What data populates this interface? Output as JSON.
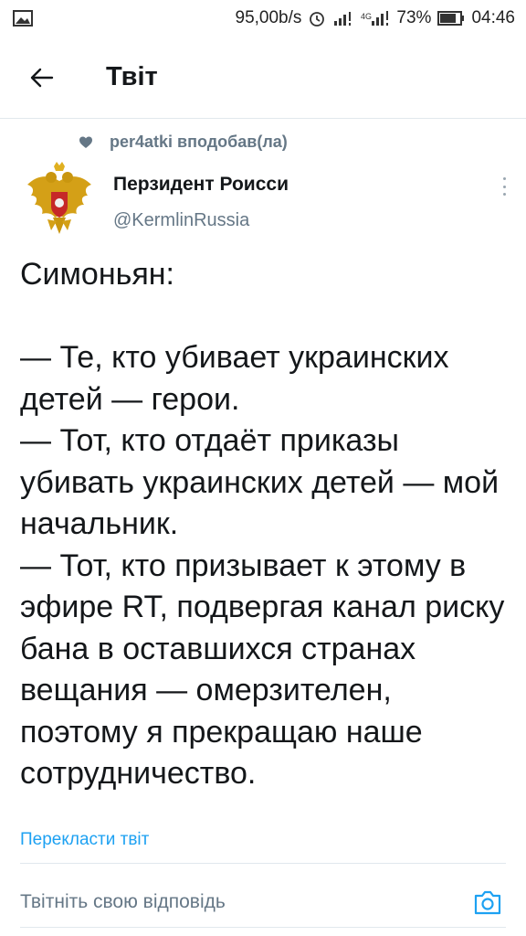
{
  "status_bar": {
    "speed": "95,00b/s",
    "network": "4G",
    "battery": "73%",
    "time": "04:46",
    "icons": [
      "image-icon",
      "alarm-icon",
      "signal-icon",
      "signal-4g-icon",
      "battery-icon"
    ]
  },
  "header": {
    "title": "Твіт",
    "back_icon": "arrow-left-icon"
  },
  "social_context": {
    "text": "per4atki вподобав(ла)",
    "icon": "heart-icon"
  },
  "tweet": {
    "author_name": "Перзидент Роисси",
    "author_handle": "@KermlinRussia",
    "avatar": "coat-of-arms-avatar",
    "text": "Симоньян:\n\n— Те, кто убивает украинских детей — герои.\n— Тот, кто отдаёт приказы убивать украинских детей — мой начальник.\n— Тот, кто призывает к этому в эфире RT, подвергая канал риску бана в оставшихся странах вещания — омерзителен, поэтому я прекращаю наше сотрудничество.",
    "translate_label": "Перекласти твіт"
  },
  "reply": {
    "placeholder": "Твітніть свою відповідь",
    "camera_icon": "camera-icon"
  },
  "colors": {
    "accent": "#1da1f2",
    "secondary_text": "#657786",
    "primary_text": "#14171a",
    "divider": "#e1e8ed"
  }
}
